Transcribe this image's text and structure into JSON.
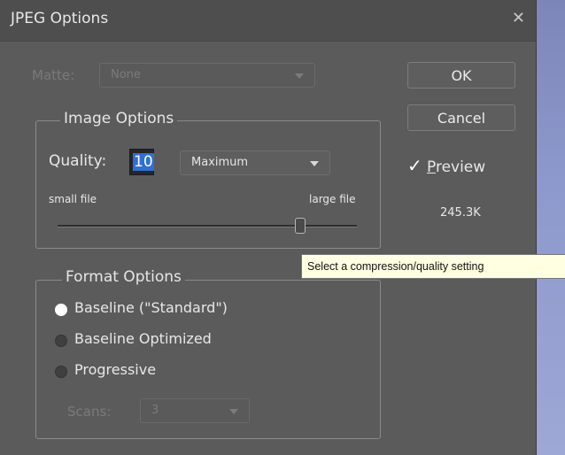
{
  "dialog": {
    "title": "JPEG Options"
  },
  "matte": {
    "label": "Matte:",
    "value": "None"
  },
  "buttons": {
    "ok": "OK",
    "cancel": "Cancel"
  },
  "preview": {
    "prefix": "✓",
    "underline": "P",
    "rest": "review",
    "size": "245.3K"
  },
  "image_options": {
    "legend": "Image Options",
    "quality_label": "Quality:",
    "quality_value": "10",
    "quality_preset": "Maximum",
    "small_label": "small file",
    "large_label": "large file",
    "slider_value": 10,
    "slider_max": 12
  },
  "format_options": {
    "legend": "Format Options",
    "options": [
      {
        "label": "Baseline (\"Standard\")",
        "selected": true
      },
      {
        "label": "Baseline Optimized",
        "selected": false
      },
      {
        "label": "Progressive",
        "selected": false
      }
    ],
    "scans_label": "Scans:",
    "scans_value": "3"
  },
  "tooltip": {
    "text": "Select a compression/quality setting"
  }
}
